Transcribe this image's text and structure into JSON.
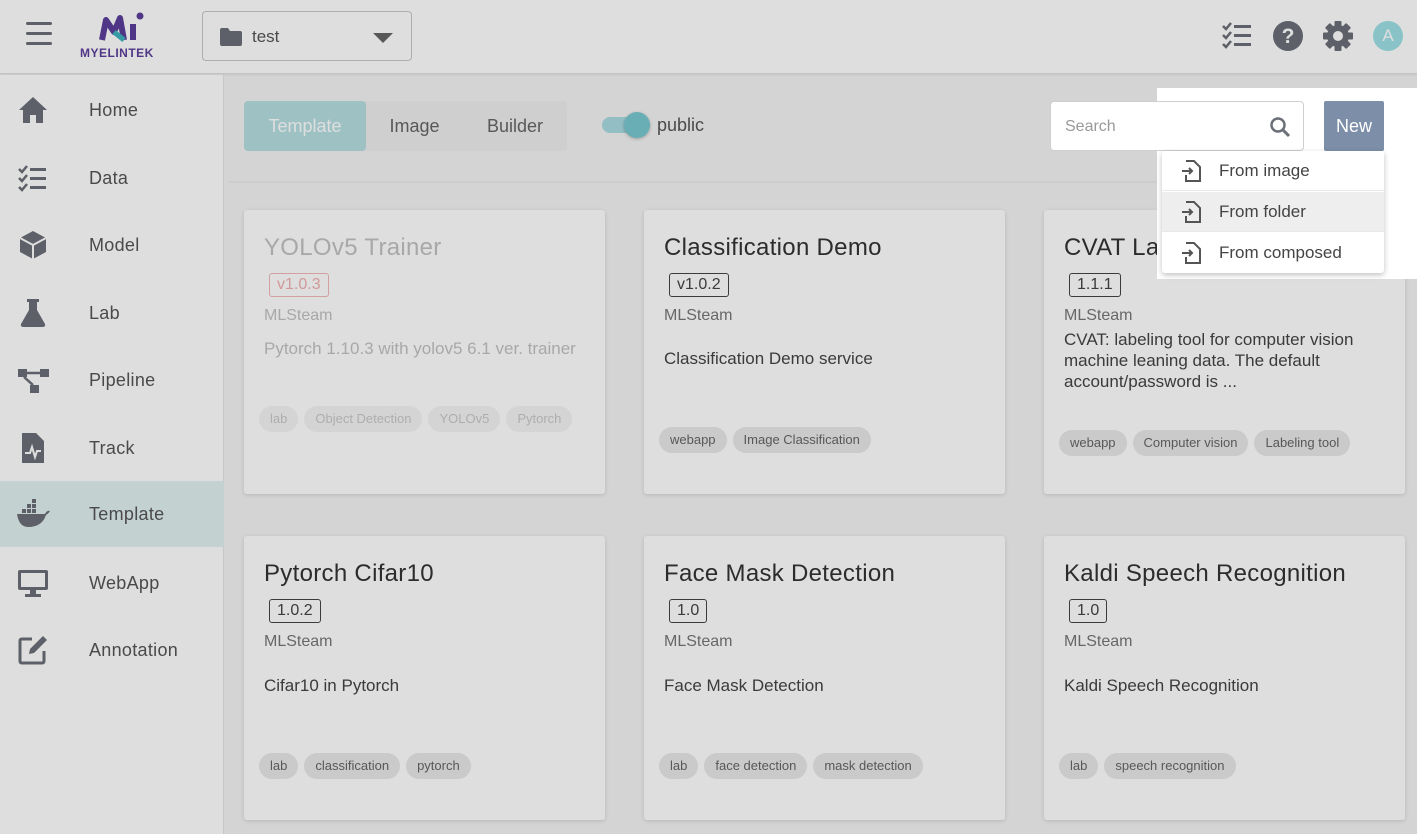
{
  "header": {
    "logo_text": "MYELINTEK",
    "project_name": "test",
    "avatar_letter": "A"
  },
  "sidebar": {
    "items": [
      {
        "label": "Home",
        "icon": "home-icon"
      },
      {
        "label": "Data",
        "icon": "checklist-icon"
      },
      {
        "label": "Model",
        "icon": "cube-icon"
      },
      {
        "label": "Lab",
        "icon": "flask-icon"
      },
      {
        "label": "Pipeline",
        "icon": "pipeline-icon"
      },
      {
        "label": "Track",
        "icon": "track-file-icon"
      },
      {
        "label": "Template",
        "icon": "docker-icon",
        "active": true
      },
      {
        "label": "WebApp",
        "icon": "monitor-icon"
      },
      {
        "label": "Annotation",
        "icon": "edit-icon"
      }
    ]
  },
  "toolbar": {
    "tabs": [
      "Template",
      "Image",
      "Builder"
    ],
    "active_tab": "Template",
    "toggle_label": "public",
    "toggle_on": true,
    "search_placeholder": "Search",
    "new_label": "New"
  },
  "new_menu": {
    "items": [
      "From image",
      "From folder",
      "From composed"
    ],
    "hovered": "From folder"
  },
  "cards": [
    {
      "title": "YOLOv5 Trainer",
      "version": "v1.0.3",
      "author": "MLSteam",
      "description": "Pytorch 1.10.3 with yolov5 6.1 ver. trainer",
      "tags": [
        "lab",
        "Object Detection",
        "YOLOv5",
        "Pytorch"
      ],
      "faded": true
    },
    {
      "title": "Classification Demo",
      "version": "v1.0.2",
      "author": "MLSteam",
      "description": "Classification Demo service",
      "tags": [
        "webapp",
        "Image Classification"
      ]
    },
    {
      "title": "CVAT La",
      "version": "1.1.1",
      "author": "MLSteam",
      "description": "CVAT: labeling tool for computer vision machine leaning data. The default account/password is ...",
      "tags": [
        "webapp",
        "Computer vision",
        "Labeling tool"
      ]
    },
    {
      "title": "Pytorch Cifar10",
      "version": "1.0.2",
      "author": "MLSteam",
      "description": "Cifar10 in Pytorch",
      "tags": [
        "lab",
        "classification",
        "pytorch"
      ]
    },
    {
      "title": "Face Mask Detection",
      "version": "1.0",
      "author": "MLSteam",
      "description": "Face Mask Detection",
      "tags": [
        "lab",
        "face detection",
        "mask detection"
      ]
    },
    {
      "title": "Kaldi Speech Recognition",
      "version": "1.0",
      "author": "MLSteam",
      "description": "Kaldi Speech Recognition",
      "tags": [
        "lab",
        "speech recognition"
      ]
    }
  ],
  "colors": {
    "accent": "#79c8cf",
    "brand": "#5b3f9a",
    "new_button": "#7d8fa8",
    "active_nav": "#e1f0f1"
  }
}
